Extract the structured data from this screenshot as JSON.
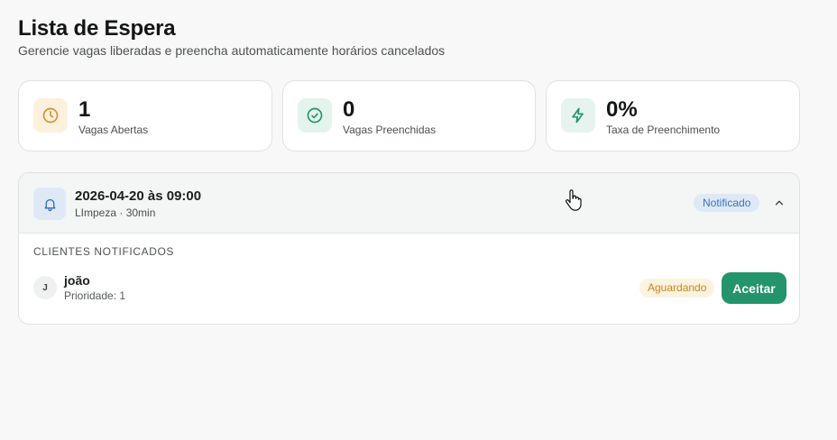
{
  "header": {
    "title": "Lista de Espera",
    "subtitle": "Gerencie vagas liberadas e preencha automaticamente horários cancelados"
  },
  "stats": [
    {
      "value": "1",
      "label": "Vagas Abertas",
      "icon": "clock-icon",
      "color": "#d9902a",
      "bg": "#fdf1de"
    },
    {
      "value": "0",
      "label": "Vagas Preenchidas",
      "icon": "check-circle-icon",
      "color": "#23946b",
      "bg": "#e3f4ec"
    },
    {
      "value": "0%",
      "label": "Taxa de Preenchimento",
      "icon": "lightning-icon",
      "color": "#23946b",
      "bg": "#e6f3ee"
    }
  ],
  "slot": {
    "datetime": "2026-04-20 às 09:00",
    "meta": "LImpeza · 30min",
    "status": "Notificado",
    "icon": "bell-icon",
    "section_label": "CLIENTES NOTIFICADOS",
    "clients": [
      {
        "initial": "J",
        "name": "joão",
        "priority": "Prioridade: 1",
        "status": "Aguardando",
        "action": "Aceitar"
      }
    ]
  },
  "colors": {
    "accent": "#23946b",
    "info": "#3973c2",
    "warning": "#c8861f"
  }
}
